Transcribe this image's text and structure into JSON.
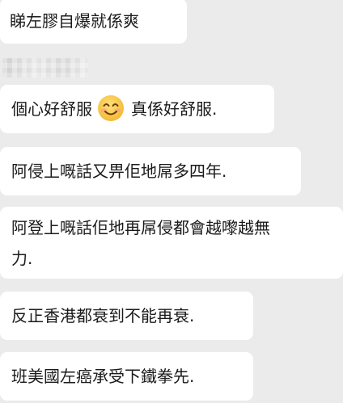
{
  "chat": {
    "messages": [
      {
        "text": "睇左膠自爆就係爽"
      },
      {
        "before": "個心好舒服",
        "emoji": "smiling-face-emoji",
        "after": "真係好舒服."
      },
      {
        "text": "阿侵上嘅話又畀佢地屌多四年."
      },
      {
        "line1": "阿登上嘅話佢地再屌侵都會越嚟越無",
        "line2": "力."
      },
      {
        "text": "反正香港都衰到不能再衰."
      },
      {
        "text": "班美國左癌承受下鐵拳先."
      }
    ],
    "sender_name_pixelated": true
  },
  "colors": {
    "background": "#ebebeb",
    "bubble": "#ffffff",
    "text": "#1a1a1a",
    "emoji_face": "#f7c948"
  }
}
